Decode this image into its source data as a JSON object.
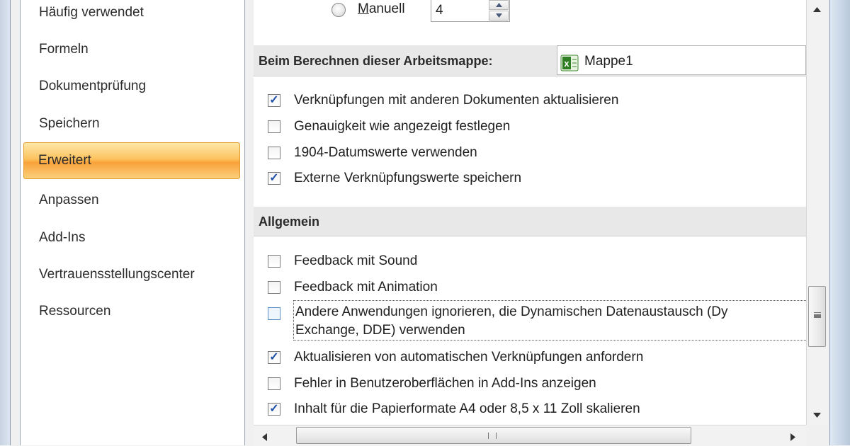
{
  "sidebar": {
    "items": [
      {
        "label": "Häufig verwendet"
      },
      {
        "label": "Formeln"
      },
      {
        "label": "Dokumentprüfung"
      },
      {
        "label": "Speichern"
      },
      {
        "label": "Erweitert",
        "selected": true
      },
      {
        "label": "Anpassen"
      },
      {
        "label": "Add-Ins"
      },
      {
        "label": "Vertrauensstellungscenter"
      },
      {
        "label": "Ressourcen"
      }
    ]
  },
  "calc": {
    "manual_label": "Manuell",
    "manual_selected": false,
    "iterations_value": "4"
  },
  "workbook_section": {
    "label": "Beim Berechnen dieser Arbeitsmappe:",
    "workbook": "Mappe1",
    "options": [
      {
        "label": "Verknüpfungen mit anderen Dokumenten aktualisieren",
        "checked": true
      },
      {
        "label": "Genauigkeit wie angezeigt festlegen",
        "checked": false
      },
      {
        "label": "1904-Datumswerte verwenden",
        "checked": false
      },
      {
        "label": "Externe Verknüpfungswerte speichern",
        "checked": true
      }
    ]
  },
  "general_section": {
    "title": "Allgemein",
    "options": [
      {
        "label": "Feedback mit Sound",
        "checked": false
      },
      {
        "label": "Feedback mit Animation",
        "checked": false
      },
      {
        "label": "Andere Anwendungen ignorieren, die Dynamischen Datenaustausch (Dy",
        "label2": "Exchange, DDE) verwenden",
        "checked": false
      },
      {
        "label": "Aktualisieren von automatischen Verknüpfungen anfordern",
        "checked": true
      },
      {
        "label": "Fehler in Benutzeroberflächen in Add-Ins anzeigen",
        "checked": false
      },
      {
        "label": "Inhalt für die Papierformate A4 oder 8,5 x 11 Zoll skalieren",
        "checked": true
      }
    ]
  },
  "icons": {
    "excel": "excel-workbook-icon",
    "scroll_up": "scroll-up-icon",
    "scroll_down": "scroll-down-icon",
    "scroll_left": "scroll-left-icon",
    "scroll_right": "scroll-right-icon",
    "spin_up": "spin-up-icon",
    "spin_down": "spin-down-icon"
  }
}
